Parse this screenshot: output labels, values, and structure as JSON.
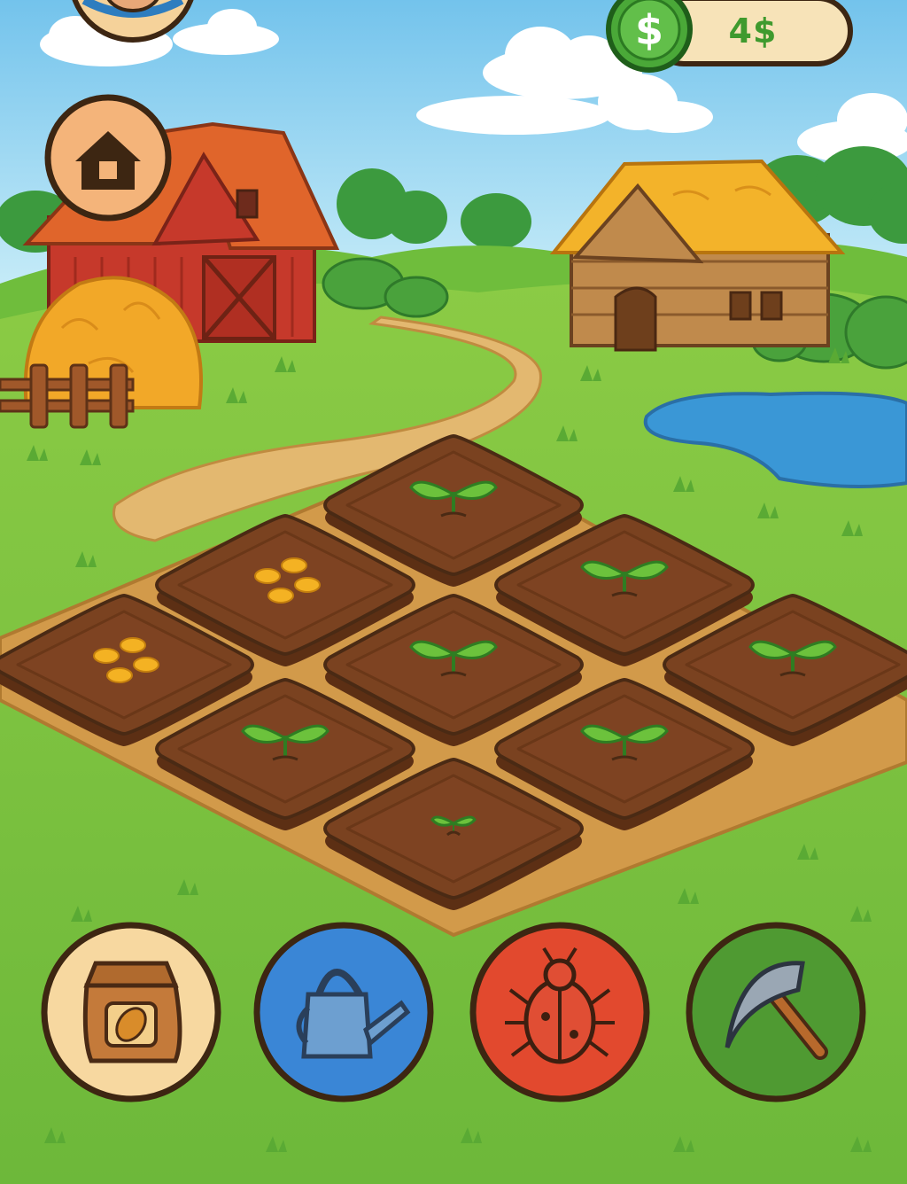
{
  "hud": {
    "coins": "4$",
    "currency_symbol": "$",
    "home_icon": "home-icon",
    "avatar_icon": "farmer-avatar-icon",
    "coin_icon": "dollar-coin-icon"
  },
  "farm": {
    "plots": [
      {
        "id": "top",
        "state": "sprout"
      },
      {
        "id": "upper-left",
        "state": "seeds"
      },
      {
        "id": "upper-right",
        "state": "sprout"
      },
      {
        "id": "left",
        "state": "seeds"
      },
      {
        "id": "center",
        "state": "sprout"
      },
      {
        "id": "right",
        "state": "sprout"
      },
      {
        "id": "lower-left",
        "state": "sprout"
      },
      {
        "id": "lower-right",
        "state": "sprout"
      },
      {
        "id": "bottom",
        "state": "small-sprout"
      }
    ]
  },
  "toolbar": {
    "tools": [
      {
        "name": "seed-bag",
        "icon": "seed-bag-icon",
        "color": "#f7d8a0"
      },
      {
        "name": "watering-can",
        "icon": "watering-can-icon",
        "color": "#3a86d6"
      },
      {
        "name": "bug-spray",
        "icon": "ladybug-icon",
        "color": "#e2492e"
      },
      {
        "name": "sickle",
        "icon": "sickle-icon",
        "color": "#4f9a32"
      }
    ]
  },
  "colors": {
    "sky": "#8fd0f0",
    "grass": "#7cc241",
    "soil": "#7a4220",
    "outline": "#4a2a14"
  }
}
